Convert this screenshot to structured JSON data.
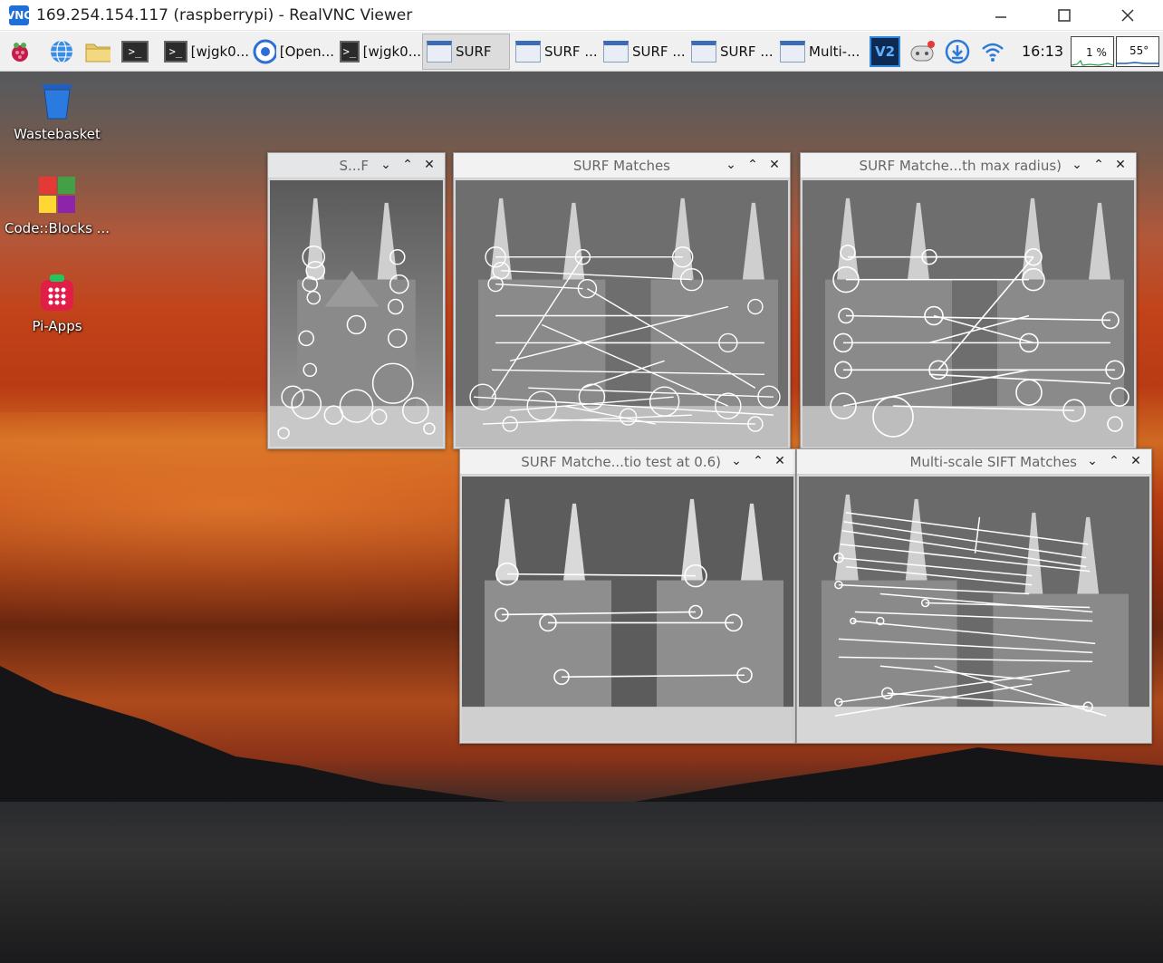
{
  "viewer": {
    "title": "169.254.154.117 (raspberrypi) - RealVNC Viewer",
    "logo": "VNC",
    "minimize_icon": "minimize-icon",
    "maximize_icon": "maximize-icon",
    "close_icon": "close-icon"
  },
  "taskbar": {
    "launchers": [
      "raspberry-menu-icon",
      "web-browser-icon",
      "file-manager-icon",
      "terminal-icon"
    ],
    "buttons": [
      {
        "label": "[wjgk0...",
        "icon": "terminal-icon"
      },
      {
        "label": "[Open...",
        "icon": "chromium-icon"
      },
      {
        "label": "[wjgk0...",
        "icon": "terminal-icon"
      },
      {
        "label": "SURF",
        "icon": "window-icon",
        "active": true
      },
      {
        "label": "SURF ...",
        "icon": "window-icon"
      },
      {
        "label": "SURF ...",
        "icon": "window-icon"
      },
      {
        "label": "SURF ...",
        "icon": "window-icon"
      },
      {
        "label": "Multi-...",
        "icon": "window-icon"
      }
    ],
    "tray": [
      "vnc-server-icon",
      "bluetooth-icon",
      "updates-icon",
      "wifi-icon"
    ],
    "clock": "16:13",
    "cpu": "1 %",
    "temp": "55°"
  },
  "desktop_icons": [
    {
      "label": "Wastebasket",
      "icon": "wastebasket-icon"
    },
    {
      "label": "Code::Blocks ...",
      "icon": "codeblocks-icon"
    },
    {
      "label": "Pi-Apps",
      "icon": "pi-apps-icon"
    }
  ],
  "windows": {
    "w1": {
      "title": "S...F"
    },
    "w2": {
      "title": "SURF Matches"
    },
    "w3": {
      "title": "SURF Matche...th max radius)"
    },
    "w4": {
      "title": "SURF Matche...tio test at 0.6)"
    },
    "w5": {
      "title": "Multi-scale SIFT Matches"
    }
  },
  "window_controls": {
    "menu": "⌄",
    "shade": "⌃",
    "close": "✕"
  },
  "colors": {
    "taskbar": "#f0f0f0",
    "active_button": "#dcdcdc",
    "vnc_blue": "#1e6fd9"
  }
}
